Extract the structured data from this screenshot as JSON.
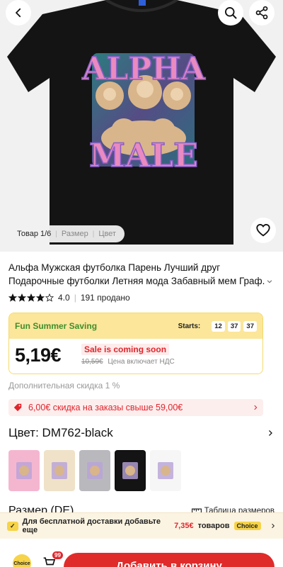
{
  "gallery": {
    "counter": "Товар 1/6",
    "size_tab": "Размер",
    "color_tab": "Цвет",
    "print_top": "ALPHA",
    "print_bottom": "MALE"
  },
  "product": {
    "title_line1": "Альфа Мужская футболка Парень Лучший друг",
    "title_line2": "Подарочные футболки Летняя мода Забавный мем Граф.",
    "rating_value": "4.0",
    "rating_stars": 4,
    "sold": "191 продано"
  },
  "promo": {
    "name": "Fun Summer Saving",
    "starts_label": "Starts:",
    "timer": [
      "12",
      "37",
      "37"
    ],
    "price": "5,19€",
    "sale_text": "Sale is coming soon",
    "old_price": "10,59€",
    "vat_note": "Цена включает НДС"
  },
  "extra_discount": "Дополнительная скидка 1 %",
  "coupon": {
    "text": "6,00€ скидка на заказы свыше 59,00€"
  },
  "color": {
    "label": "Цвет: DM762-black",
    "options": [
      {
        "name": "pink",
        "bg": "#f4b6cf"
      },
      {
        "name": "cream",
        "bg": "#efe2c8"
      },
      {
        "name": "gray",
        "bg": "#b9b9bd"
      },
      {
        "name": "black",
        "bg": "#141414"
      },
      {
        "name": "white",
        "bg": "#f6f6f6"
      }
    ],
    "selected_index": 3
  },
  "size": {
    "label": "Размер (DE)",
    "table_link": "Таблица размеров"
  },
  "shipping": {
    "prefix": "Для бесплатной доставки добавьте еще",
    "amount": "7,35€",
    "suffix": "товаров",
    "tag": "Choice"
  },
  "bottom": {
    "choice_label": "Choice",
    "cart_count": "99",
    "add_button": "Добавить в корзину"
  },
  "colors": {
    "accent_red": "#e0262d",
    "promo_yellow": "#fbe69a",
    "promo_green": "#3e8e2c",
    "shirt": "#141414"
  }
}
